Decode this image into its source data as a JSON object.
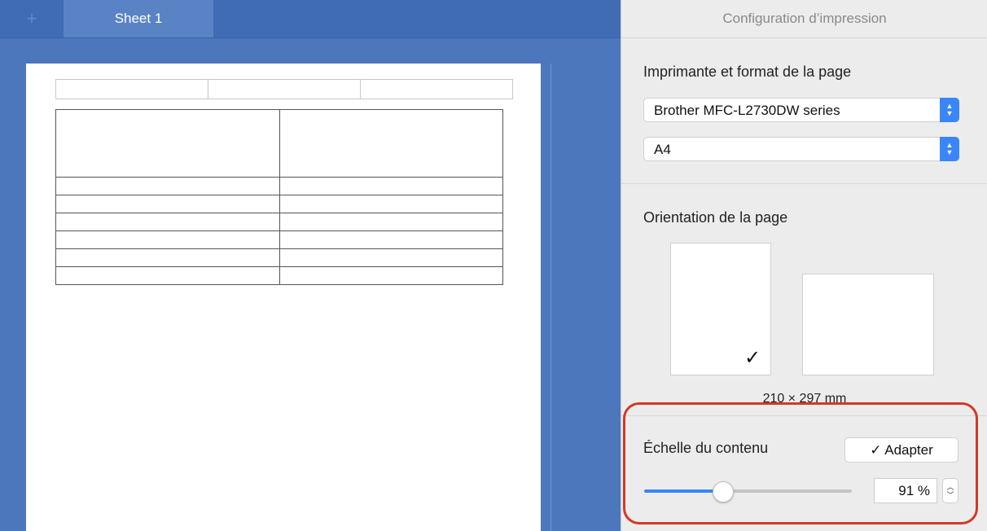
{
  "sheet": {
    "add_tab_icon": "plus-icon",
    "tab_label": "Sheet 1"
  },
  "panel": {
    "title": "Configuration d’impression",
    "printer_section_label": "Imprimante et format de la page",
    "printer_value": "Brother MFC-L2730DW series",
    "paper_value": "A4",
    "orientation_label": "Orientation de la page",
    "orientation_selected": "portrait",
    "page_dimensions": "210 × 297 mm",
    "scale_label": "Échelle du contenu",
    "adapt_button": "✓ Adapter",
    "scale_value": "91 %",
    "scale_percent": 91
  },
  "colors": {
    "accent": "#3b86f7",
    "highlight": "#d0392b",
    "sheet_blue": "#4d77bd"
  }
}
